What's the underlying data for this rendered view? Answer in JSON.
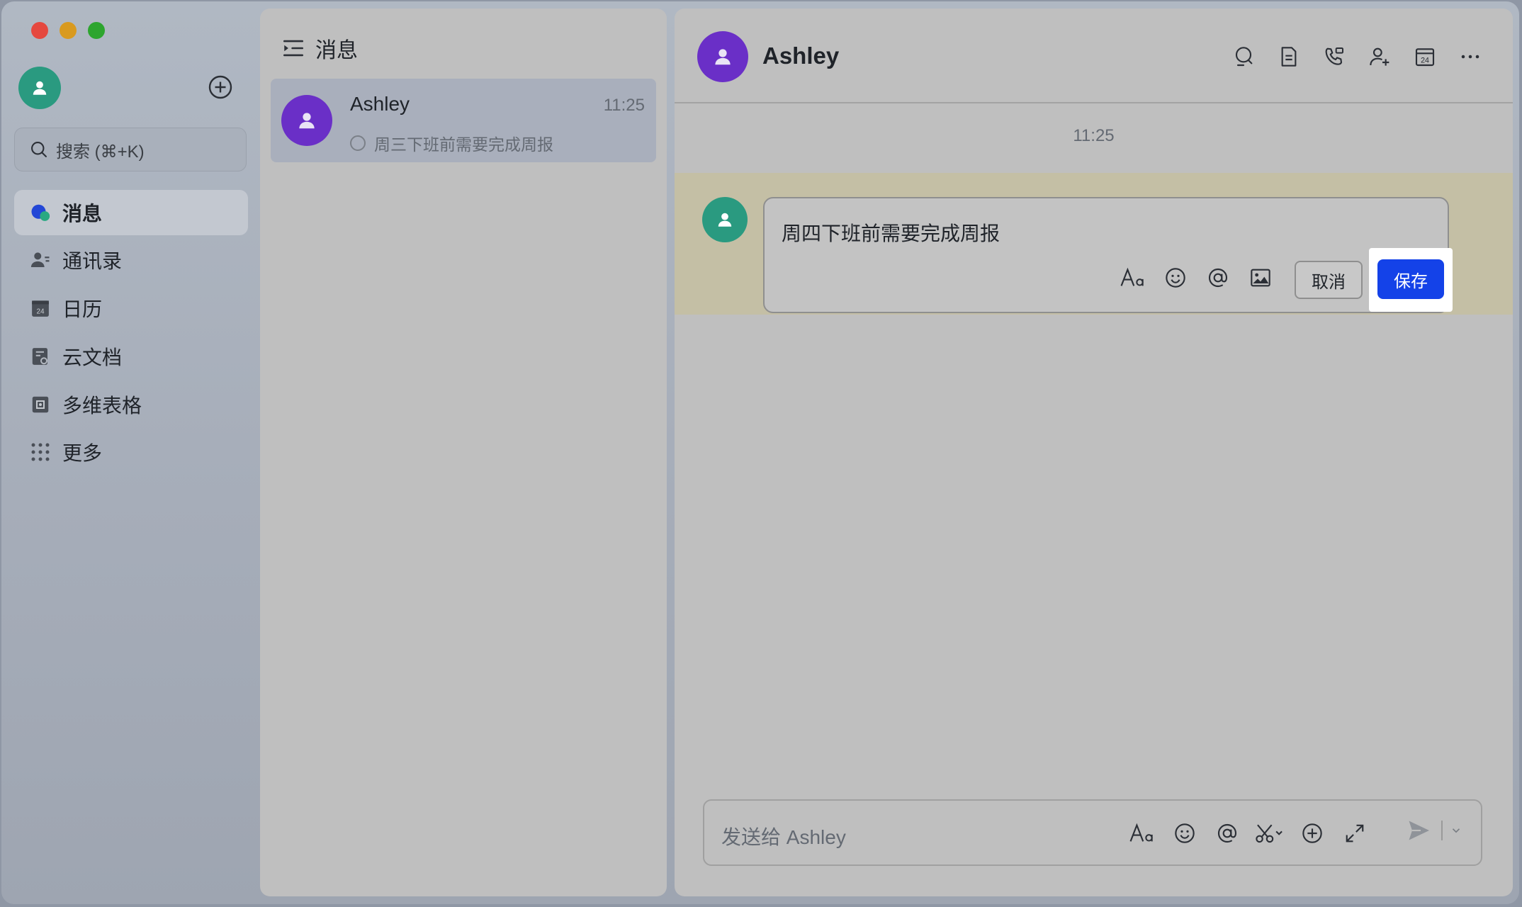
{
  "window": {
    "sidebar": {
      "search_placeholder": "搜索 (⌘+K)",
      "nav": [
        {
          "label": "消息",
          "icon": "messages-icon",
          "active": true
        },
        {
          "label": "通讯录",
          "icon": "contacts-icon",
          "active": false
        },
        {
          "label": "日历",
          "icon": "calendar-icon",
          "active": false
        },
        {
          "label": "云文档",
          "icon": "docs-icon",
          "active": false
        },
        {
          "label": "多维表格",
          "icon": "base-icon",
          "active": false
        },
        {
          "label": "更多",
          "icon": "more-apps-icon",
          "active": false
        }
      ]
    },
    "conversation_list": {
      "title": "消息",
      "items": [
        {
          "name": "Ashley",
          "time": "11:25",
          "preview": "周三下班前需要完成周报"
        }
      ]
    },
    "chat": {
      "contact_name": "Ashley",
      "header_icons": [
        "search-icon",
        "document-icon",
        "call-icon",
        "add-member-icon",
        "calendar-icon",
        "more-icon"
      ],
      "time_separator": "11:25",
      "editing": {
        "text": "周四下班前需要完成周报",
        "cancel_label": "取消",
        "save_label": "保存"
      },
      "composer": {
        "placeholder": "发送给 Ashley"
      }
    }
  },
  "colors": {
    "accent": "#1442e8",
    "avatar_teal": "#2a9a80",
    "avatar_purple": "#6a2fc7",
    "edit_highlight": "#c4bfa5"
  }
}
